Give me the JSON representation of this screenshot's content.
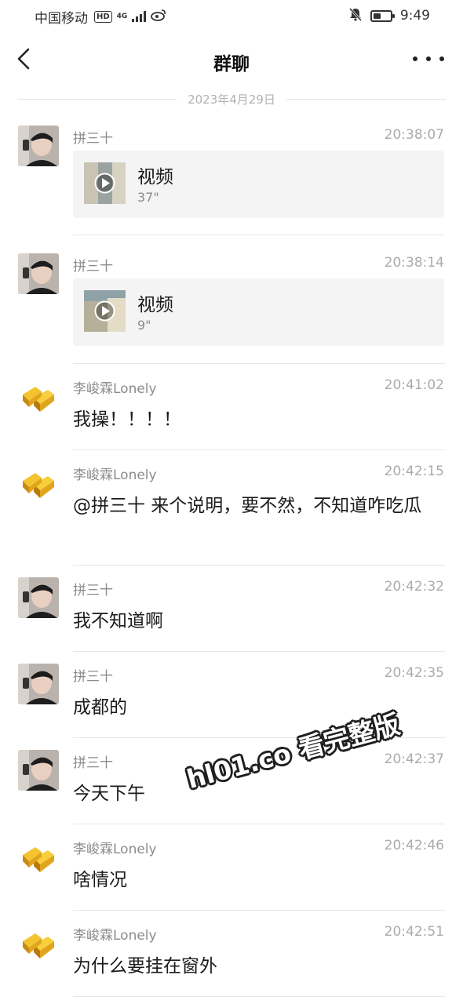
{
  "status_bar": {
    "carrier": "中国移动",
    "hd_badge": "HD",
    "network": "4G",
    "time": "9:49",
    "battery_level": 0.45
  },
  "header": {
    "title": "群聊"
  },
  "date_divider": "2023年4月29日",
  "messages": [
    {
      "sender": "拼三十",
      "time": "20:38:07",
      "type": "video",
      "video_label": "视频",
      "duration": "37\""
    },
    {
      "sender": "拼三十",
      "time": "20:38:14",
      "type": "video",
      "video_label": "视频",
      "duration": "9\""
    },
    {
      "sender": "李峻霖Lonely",
      "time": "20:41:02",
      "type": "text",
      "text": "我操！！！！"
    },
    {
      "sender": "李峻霖Lonely",
      "time": "20:42:15",
      "type": "text",
      "text": "@拼三十 来个说明，要不然，不知道咋吃瓜"
    },
    {
      "sender": "拼三十",
      "time": "20:42:32",
      "type": "text",
      "text": "我不知道啊"
    },
    {
      "sender": "拼三十",
      "time": "20:42:35",
      "type": "text",
      "text": "成都的"
    },
    {
      "sender": "拼三十",
      "time": "20:42:37",
      "type": "text",
      "text": "今天下午"
    },
    {
      "sender": "李峻霖Lonely",
      "time": "20:42:46",
      "type": "text",
      "text": "啥情况"
    },
    {
      "sender": "李峻霖Lonely",
      "time": "20:42:51",
      "type": "text",
      "text": "为什么要挂在窗外"
    }
  ],
  "watermark": "hl01.co 看完整版",
  "colors": {
    "background": "#ffffff",
    "card_bg": "#f4f4f4",
    "meta_text": "#8c8c8c",
    "gold_avatar": "#e0a51c"
  }
}
